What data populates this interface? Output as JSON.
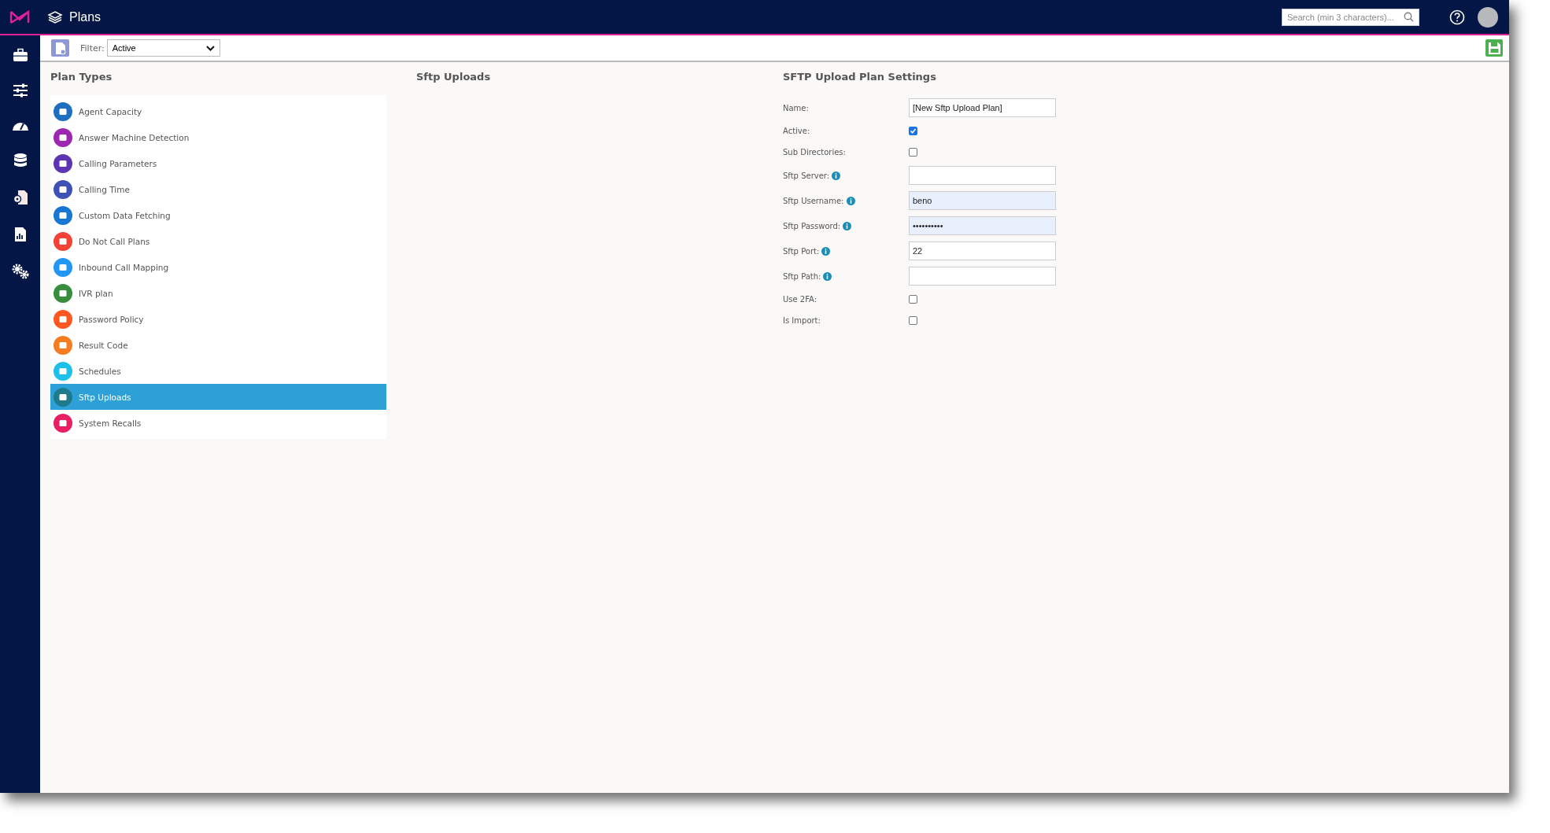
{
  "header": {
    "title": "Plans",
    "search": {
      "placeholder": "Search (min 3 characters)..."
    }
  },
  "toolbar": {
    "filter_label": "Filter:",
    "filter_value": "Active"
  },
  "plan_types": {
    "title": "Plan Types",
    "items": [
      {
        "label": "Agent Capacity",
        "color": "#1e6fc0",
        "selected": false
      },
      {
        "label": "Answer Machine Detection",
        "color": "#9c27b0",
        "selected": false
      },
      {
        "label": "Calling Parameters",
        "color": "#5e35b1",
        "selected": false
      },
      {
        "label": "Calling Time",
        "color": "#3f51b5",
        "selected": false
      },
      {
        "label": "Custom Data Fetching",
        "color": "#1976d2",
        "selected": false
      },
      {
        "label": "Do Not Call Plans",
        "color": "#f44336",
        "selected": false
      },
      {
        "label": "Inbound Call Mapping",
        "color": "#2196f3",
        "selected": false
      },
      {
        "label": "IVR plan",
        "color": "#388e3c",
        "selected": false
      },
      {
        "label": "Password Policy",
        "color": "#ff5722",
        "selected": false
      },
      {
        "label": "Result Code",
        "color": "#f57c20",
        "selected": false
      },
      {
        "label": "Schedules",
        "color": "#1ec0ea",
        "selected": false
      },
      {
        "label": "Sftp Uploads",
        "color": "#1f7a8c",
        "selected": true
      },
      {
        "label": "System Recalls",
        "color": "#e91e63",
        "selected": false
      }
    ]
  },
  "middle": {
    "title": "Sftp Uploads"
  },
  "settings": {
    "title": "SFTP Upload Plan Settings",
    "fields": [
      {
        "kind": "text",
        "label": "Name:",
        "info": false,
        "value": "[New Sftp Upload Plan]",
        "autofilled": false
      },
      {
        "kind": "checkbox",
        "label": "Active:",
        "checked": true
      },
      {
        "kind": "checkbox",
        "label": "Sub Directories:",
        "checked": false
      },
      {
        "kind": "text",
        "label": "Sftp Server:",
        "info": true,
        "autofilled": false
      },
      {
        "kind": "text",
        "label": "Sftp Username:",
        "info": true,
        "value": "beno",
        "autofilled": true
      },
      {
        "kind": "text",
        "label": "Sftp Password:",
        "info": true,
        "value": "••••••••••",
        "autofilled": true
      },
      {
        "kind": "text",
        "label": "Sftp Port:",
        "info": true,
        "value": "22",
        "autofilled": false
      },
      {
        "kind": "text",
        "label": "Sftp Path:",
        "info": true,
        "autofilled": false
      },
      {
        "kind": "checkbox",
        "label": "Use 2FA:",
        "checked": false
      },
      {
        "kind": "checkbox",
        "label": "Is Import:",
        "checked": false
      }
    ]
  }
}
